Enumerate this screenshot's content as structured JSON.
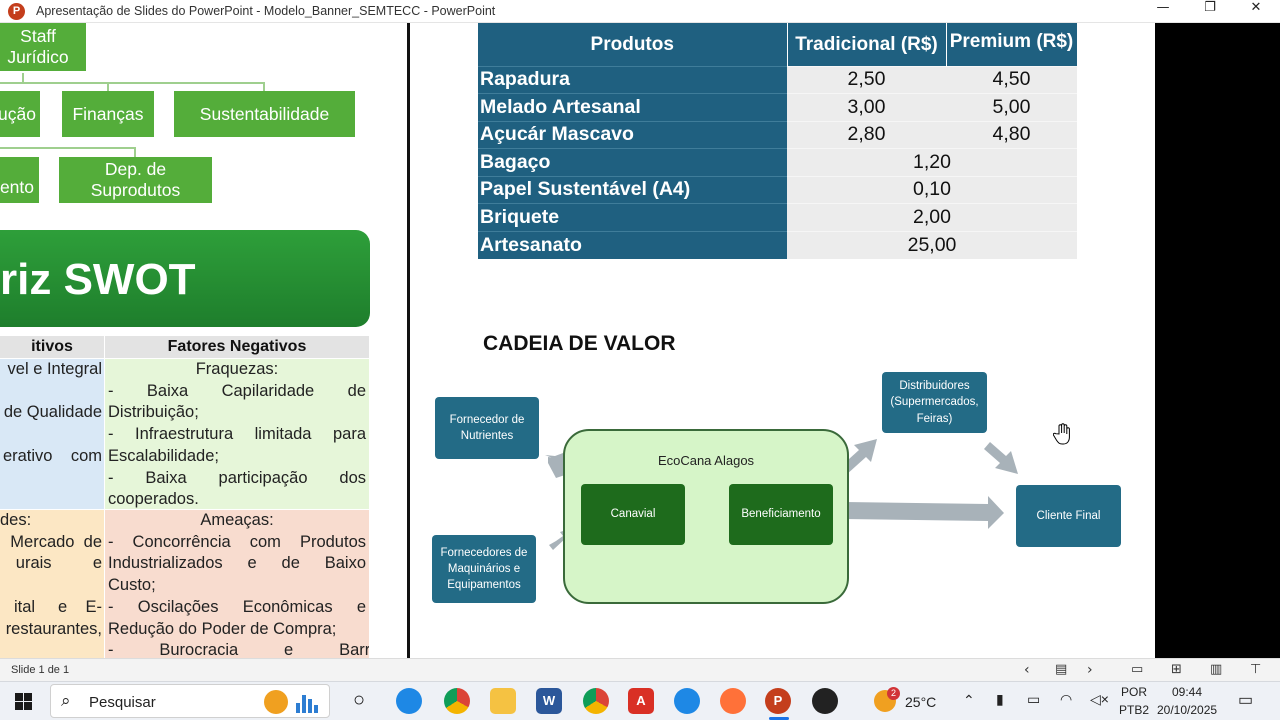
{
  "window": {
    "title": "Apresentação de Slides do PowerPoint  -  Modelo_Banner_SEMTECC  -  PowerPoint",
    "app_icon_letter": "P",
    "minimize_glyph": "—",
    "restore_glyph": "❐",
    "close_glyph": "✕"
  },
  "org_chart": {
    "staff": "Staff Jurídico",
    "producao_partial": "ução",
    "financas": "Finanças",
    "sustentabilidade": "Sustentabilidade",
    "partial2": "ento",
    "subprodutos": "Dep. de Suprodutos"
  },
  "swot": {
    "title": "riz SWOT",
    "header_positive": "itivos",
    "header_negative": "Fatores Negativos",
    "strengths_lines": [
      "vel e Integral",
      "",
      "de Qualidade",
      "",
      "erativo    com",
      ""
    ],
    "weaknesses": {
      "title": "Fraquezas:",
      "lines": [
        "-     Baixa     Capilaridade     de",
        "Distribuição;",
        "-  Infraestrutura  limitada  para",
        "Escalabilidade;",
        "-      Baixa      participação      dos",
        "cooperados."
      ]
    },
    "opportunities_lines": [
      "des:",
      "Mercado  de",
      "urais         e",
      "",
      "ital     e    E-",
      "restaurantes,"
    ],
    "threats": {
      "title": "Ameaças:",
      "lines": [
        "-  Concorrência  com  Produtos",
        "Industrializados     e     de     Baixo",
        "Custo;",
        "-  Oscilações  Econômicas  e",
        "Redução do Poder de Compra;",
        "-          Burocracia          e          Barreias"
      ]
    }
  },
  "products_table": {
    "headers": [
      "Produtos",
      "Tradicional (R$)",
      "Premium (R$)"
    ],
    "rows": [
      {
        "name": "Rapadura",
        "tradicional": "2,50",
        "premium": "4,50"
      },
      {
        "name": "Melado Artesanal",
        "tradicional": "3,00",
        "premium": "5,00"
      },
      {
        "name": "Açucár Mascavo",
        "tradicional": "2,80",
        "premium": "4,80"
      },
      {
        "name": "Bagaço",
        "single": "1,20"
      },
      {
        "name": "Papel Sustentável (A4)",
        "single": "0,10"
      },
      {
        "name": "Briquete",
        "single": "2,00"
      },
      {
        "name": "Artesanato",
        "single": "25,00"
      }
    ]
  },
  "value_chain": {
    "title": "CADEIA DE VALOR",
    "fornecedor_nutrientes": "Fornecedor de Nutrientes",
    "fornecedores_maquinarios": "Fornecedores de Maquinários e Equipamentos",
    "ecocana": "EcoCana Alagos",
    "canavial": "Canavial",
    "beneficiamento": "Beneficiamento",
    "distribuidores": "Distribuidores (Supermercados, Feiras)",
    "cliente_final": "Cliente Final"
  },
  "statusbar": {
    "slide_counter": "Slide 1 de 1"
  },
  "taskbar": {
    "search_placeholder": "Pesquisar",
    "weather_temp": "25°C",
    "weather_badge": "2",
    "lang_top": "POR",
    "lang_bottom": "PTB2",
    "time": "09:44",
    "date": "20/10/2025"
  }
}
